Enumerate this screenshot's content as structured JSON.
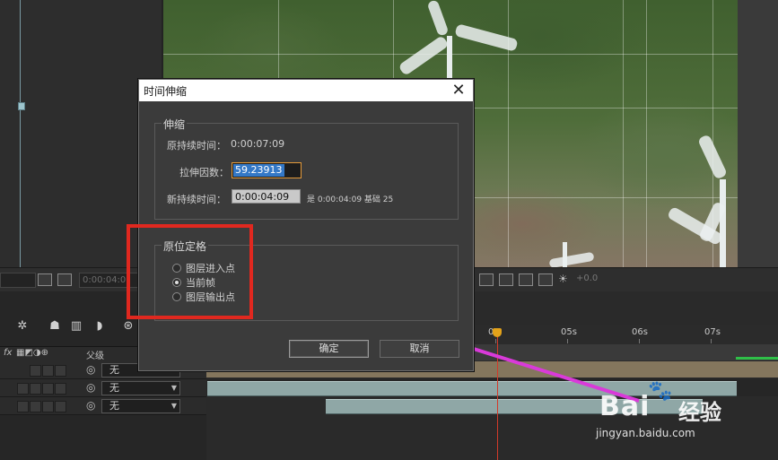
{
  "dialog": {
    "title": "时间伸缩",
    "stretch_group": {
      "title": "伸缩",
      "original_duration_label": "原持续时间：",
      "original_duration_value": "0:00:07:09",
      "stretch_factor_label": "拉伸因数：",
      "stretch_factor_value": "59.23913",
      "new_duration_label": "新持续时间：",
      "new_duration_value": "0:00:04:09",
      "new_duration_note": "是 0:00:04:09  基础 25"
    },
    "hold_group": {
      "title": "原位定格",
      "options": [
        "图层进入点",
        "当前帧",
        "图层输出点"
      ],
      "selected_index": 1
    },
    "ok_label": "确定",
    "cancel_label": "取消"
  },
  "viewer": {
    "timecode_left": "0:00:04:0",
    "zoom_value": "+0.0"
  },
  "timeline": {
    "column_parent": "父级",
    "fx_label": "fx",
    "rows": [
      {
        "parent": "无",
        "has_dropdown_arrow": false
      },
      {
        "parent": "无",
        "has_dropdown_arrow": true
      },
      {
        "parent": "无",
        "has_dropdown_arrow": true
      }
    ],
    "ruler_labels": [
      "0",
      "05s",
      "06s",
      "07s"
    ]
  },
  "watermark": {
    "logo_text": "Bai",
    "brand_text": "经验",
    "url": "jingyan.baidu.com",
    "paw_icon": "baidu-paw-icon"
  },
  "colors": {
    "annotation_red": "#e0281f",
    "annotation_arrow": "#d93ad9",
    "selection_blue": "#3478c6",
    "field_focus_orange": "#e49a3a",
    "playhead_red": "#d23a2a"
  }
}
